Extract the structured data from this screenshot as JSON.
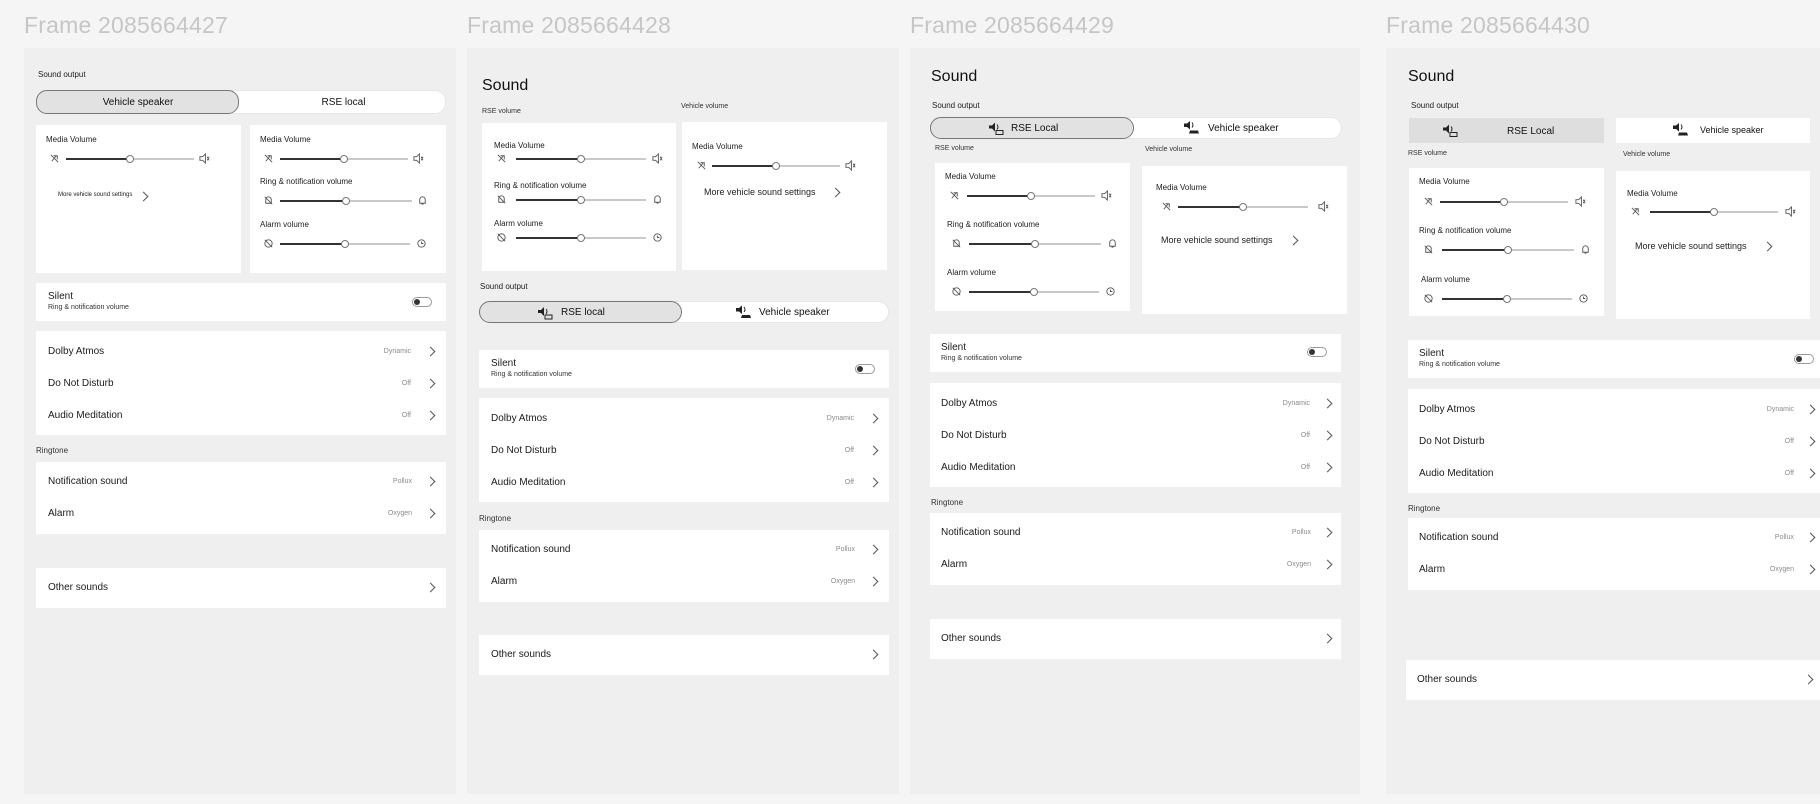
{
  "frames": [
    {
      "title": "Frame 2085664427"
    },
    {
      "title": "Frame 2085664428"
    },
    {
      "title": "Frame 2085664429"
    },
    {
      "title": "Frame 2085664430"
    }
  ],
  "labels": {
    "sound_output": "Sound output",
    "sound_title": "Sound",
    "vehicle_speaker": "Vehicle speaker",
    "rse_local": "RSE local",
    "rse_local_cap": "RSE Local",
    "rse_volume": "RSE volume",
    "vehicle_volume": "Vehicle volume",
    "media_volume": "Media Volume",
    "ring_volume": "Ring & notification volume",
    "alarm_volume": "Alarm volume",
    "more_vehicle": "More vehicle sound settings",
    "silent": "Silent",
    "silent_sub": "Ring & notification volume",
    "ringtone": "Ringtone",
    "other_sounds": "Other sounds"
  },
  "settings": [
    {
      "label": "Dolby Atmos",
      "value": "Dynamic"
    },
    {
      "label": "Do Not Disturb",
      "value": "Off"
    },
    {
      "label": "Audio Meditation",
      "value": "Off"
    }
  ],
  "ringtones": [
    {
      "label": "Notification sound",
      "value": "Pollux"
    },
    {
      "label": "Alarm",
      "value": "Oxygen"
    }
  ],
  "volume_levels": {
    "media": 0.5,
    "ring": 0.5,
    "alarm": 0.5,
    "vehicle_media": 0.5
  },
  "colors": {
    "background": "#f5f5f5",
    "frame": "#efefef",
    "card": "#ffffff",
    "selected_segment": "#e2e2e2",
    "frame_title": "#c6c6c6"
  },
  "icons": [
    "media-muted-icon",
    "speaker-icon",
    "bell-muted-icon",
    "bell-icon",
    "alarm-off-icon",
    "clock-icon",
    "chevron-right-icon",
    "rse-speaker-icon",
    "vehicle-speaker-icon"
  ]
}
